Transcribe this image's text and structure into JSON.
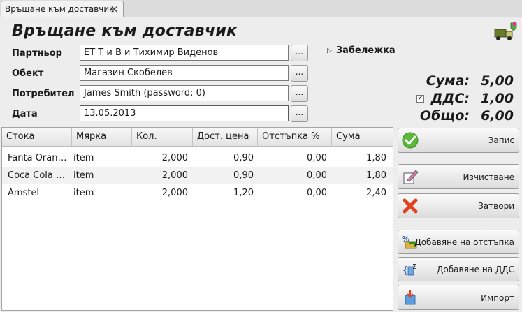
{
  "tab": {
    "label": "Връщане към доставчик",
    "close": "×"
  },
  "document": {
    "title": "Връщане към доставчик"
  },
  "fields": [
    {
      "label": "Партньор",
      "value": "ЕТ Т и В и Тихимир Виденов",
      "browse": "..."
    },
    {
      "label": "Обект",
      "value": "Магазин Скобелев",
      "browse": "..."
    },
    {
      "label": "Потребител",
      "value": "James Smith (password: 0)",
      "browse": "..."
    },
    {
      "label": "Дата",
      "value": "13.05.2013",
      "browse": "..."
    }
  ],
  "note": {
    "label": "Забележка"
  },
  "totals": {
    "sum_label": "Сума:",
    "sum_value": "5,00",
    "vat_label": "ДДС:",
    "vat_value": "1,00",
    "vat_checked": true,
    "total_label": "Общо:",
    "total_value": "6,00"
  },
  "grid": {
    "columns": [
      "Стока",
      "Мярка",
      "Кол.",
      "Дост. цена",
      "Отстъпка %",
      "Сума"
    ],
    "rows": [
      [
        "Fanta Oran…",
        "item",
        "2,000",
        "0,90",
        "0,00",
        "1,80"
      ],
      [
        "Coca Cola …",
        "item",
        "2,000",
        "0,90",
        "0,00",
        "1,80"
      ],
      [
        "Amstel",
        "item",
        "2,000",
        "1,20",
        "0,00",
        "2,40"
      ]
    ]
  },
  "buttons": {
    "save": "Запис",
    "clear": "Изчистване",
    "close": "Затвори",
    "add_discount": "Добавяне на отстъпка",
    "add_vat": "Добавяне на ДДС",
    "import": "Импорт"
  },
  "colors": {
    "save_icon": "#5cb83a",
    "close_icon": "#e0401c",
    "window_bg": "#ededed"
  },
  "icons": {
    "corner": "delivery-truck-icon",
    "save": "checkmark-icon",
    "clear": "eraser-icon",
    "close": "red-x-icon",
    "add_discount": "percent-discount-icon",
    "add_vat": "sigma-icon",
    "import": "import-box-icon"
  }
}
